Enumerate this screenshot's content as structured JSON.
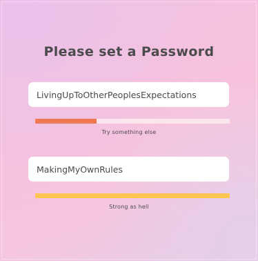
{
  "page": {
    "title": "Please set a Password"
  },
  "fields": [
    {
      "value": "LivingUpToOtherPeoplesExpectations",
      "strength_fraction": 0.315,
      "strength_color": "#ef7a52",
      "strength_label": "Try something else"
    },
    {
      "value": "MakingMyOwnRules",
      "strength_fraction": 1.0,
      "strength_color": "#ffc552",
      "strength_label": "Strong as hell"
    }
  ],
  "colors": {
    "meter_track": "#fbe6ee",
    "background_top": "#f1c2e3",
    "background_bottom": "#e7cee7"
  }
}
